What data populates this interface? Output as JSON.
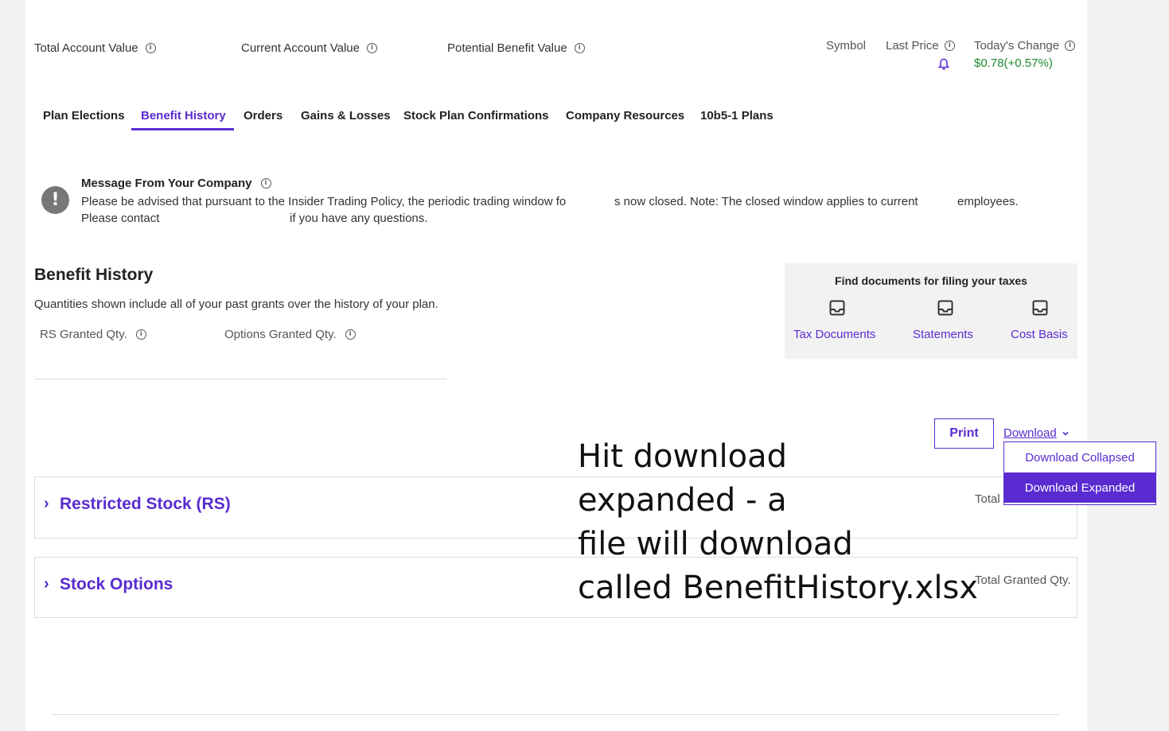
{
  "summary": {
    "total_account_value": "Total Account Value",
    "current_account_value": "Current Account Value",
    "potential_benefit_value": "Potential Benefit Value"
  },
  "quote": {
    "symbol_label": "Symbol",
    "last_price_label": "Last Price",
    "todays_change_label": "Today's Change",
    "todays_change_value": "$0.78(+0.57%)"
  },
  "tabs": [
    {
      "label": "Plan Elections"
    },
    {
      "label": "Benefit History"
    },
    {
      "label": "Orders"
    },
    {
      "label": "Gains & Losses"
    },
    {
      "label": "Stock Plan Confirmations"
    },
    {
      "label": "Company Resources"
    },
    {
      "label": "10b5-1 Plans"
    }
  ],
  "message": {
    "title": "Message From Your Company",
    "line1_a": "Please be advised that pursuant to the Insider Trading Policy, the periodic trading window fo",
    "line1_b": "s now closed. Note: The closed window applies to current",
    "line1_c": "employees.",
    "line2_a": "Please contact",
    "line2_b": "if you have any questions."
  },
  "benefit_history": {
    "title": "Benefit History",
    "subtitle": "Quantities shown include all of your past grants over the history of your plan.",
    "rs_granted_label": "RS Granted Qty.",
    "options_granted_label": "Options Granted Qty."
  },
  "tax_docs": {
    "title": "Find documents for filing your taxes",
    "links": [
      {
        "label": "Tax Documents"
      },
      {
        "label": "Statements"
      },
      {
        "label": "Cost Basis"
      }
    ]
  },
  "actions": {
    "print_label": "Print",
    "download_label": "Download",
    "download_options": [
      {
        "label": "Download Collapsed"
      },
      {
        "label": "Download Expanded"
      }
    ]
  },
  "accordions": {
    "rs": {
      "title": "Restricted Stock (RS)",
      "total_label": "Total"
    },
    "options": {
      "title": "Stock Options",
      "total_label": "Total Granted Qty."
    }
  },
  "annotation": {
    "line1": "Hit download",
    "line2": "expanded - a",
    "line3": "file will download",
    "line4": "called BenefitHistory.xlsx"
  },
  "colors": {
    "accent": "#5a2bd1",
    "positive": "#1e8a2e"
  },
  "icons": [
    "info-icon",
    "bell-icon",
    "alert-icon",
    "inbox-icon",
    "chevron-down-icon",
    "chevron-right-icon"
  ]
}
